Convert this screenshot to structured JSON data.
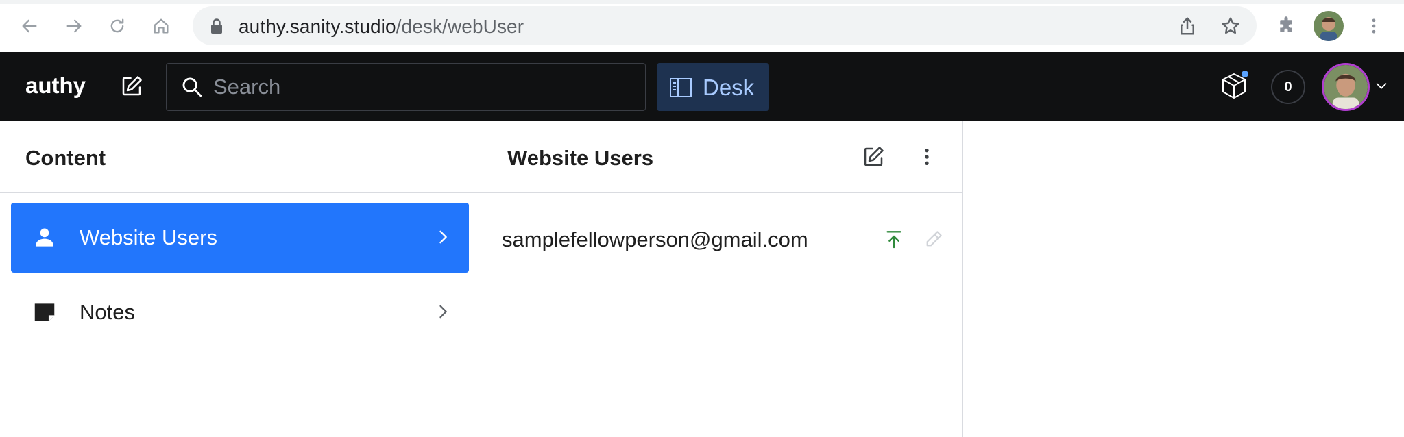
{
  "browser": {
    "url_host": "authy.sanity.studio",
    "url_path": "/desk/webUser"
  },
  "header": {
    "brand": "authy",
    "search_placeholder": "Search",
    "desk_label": "Desk",
    "notification_count": "0"
  },
  "content_pane": {
    "title": "Content",
    "items": [
      {
        "label": "Website Users",
        "icon": "person-icon",
        "active": true
      },
      {
        "label": "Notes",
        "icon": "note-icon",
        "active": false
      }
    ]
  },
  "users_pane": {
    "title": "Website Users",
    "documents": [
      {
        "title": "samplefellowperson@gmail.com",
        "status": "published"
      }
    ]
  },
  "colors": {
    "header_bg": "#101112",
    "accent": "#2276fc",
    "desk_bg": "#1e3250",
    "avatar_ring": "#b13ed0",
    "published_green": "#2f8a3b"
  }
}
